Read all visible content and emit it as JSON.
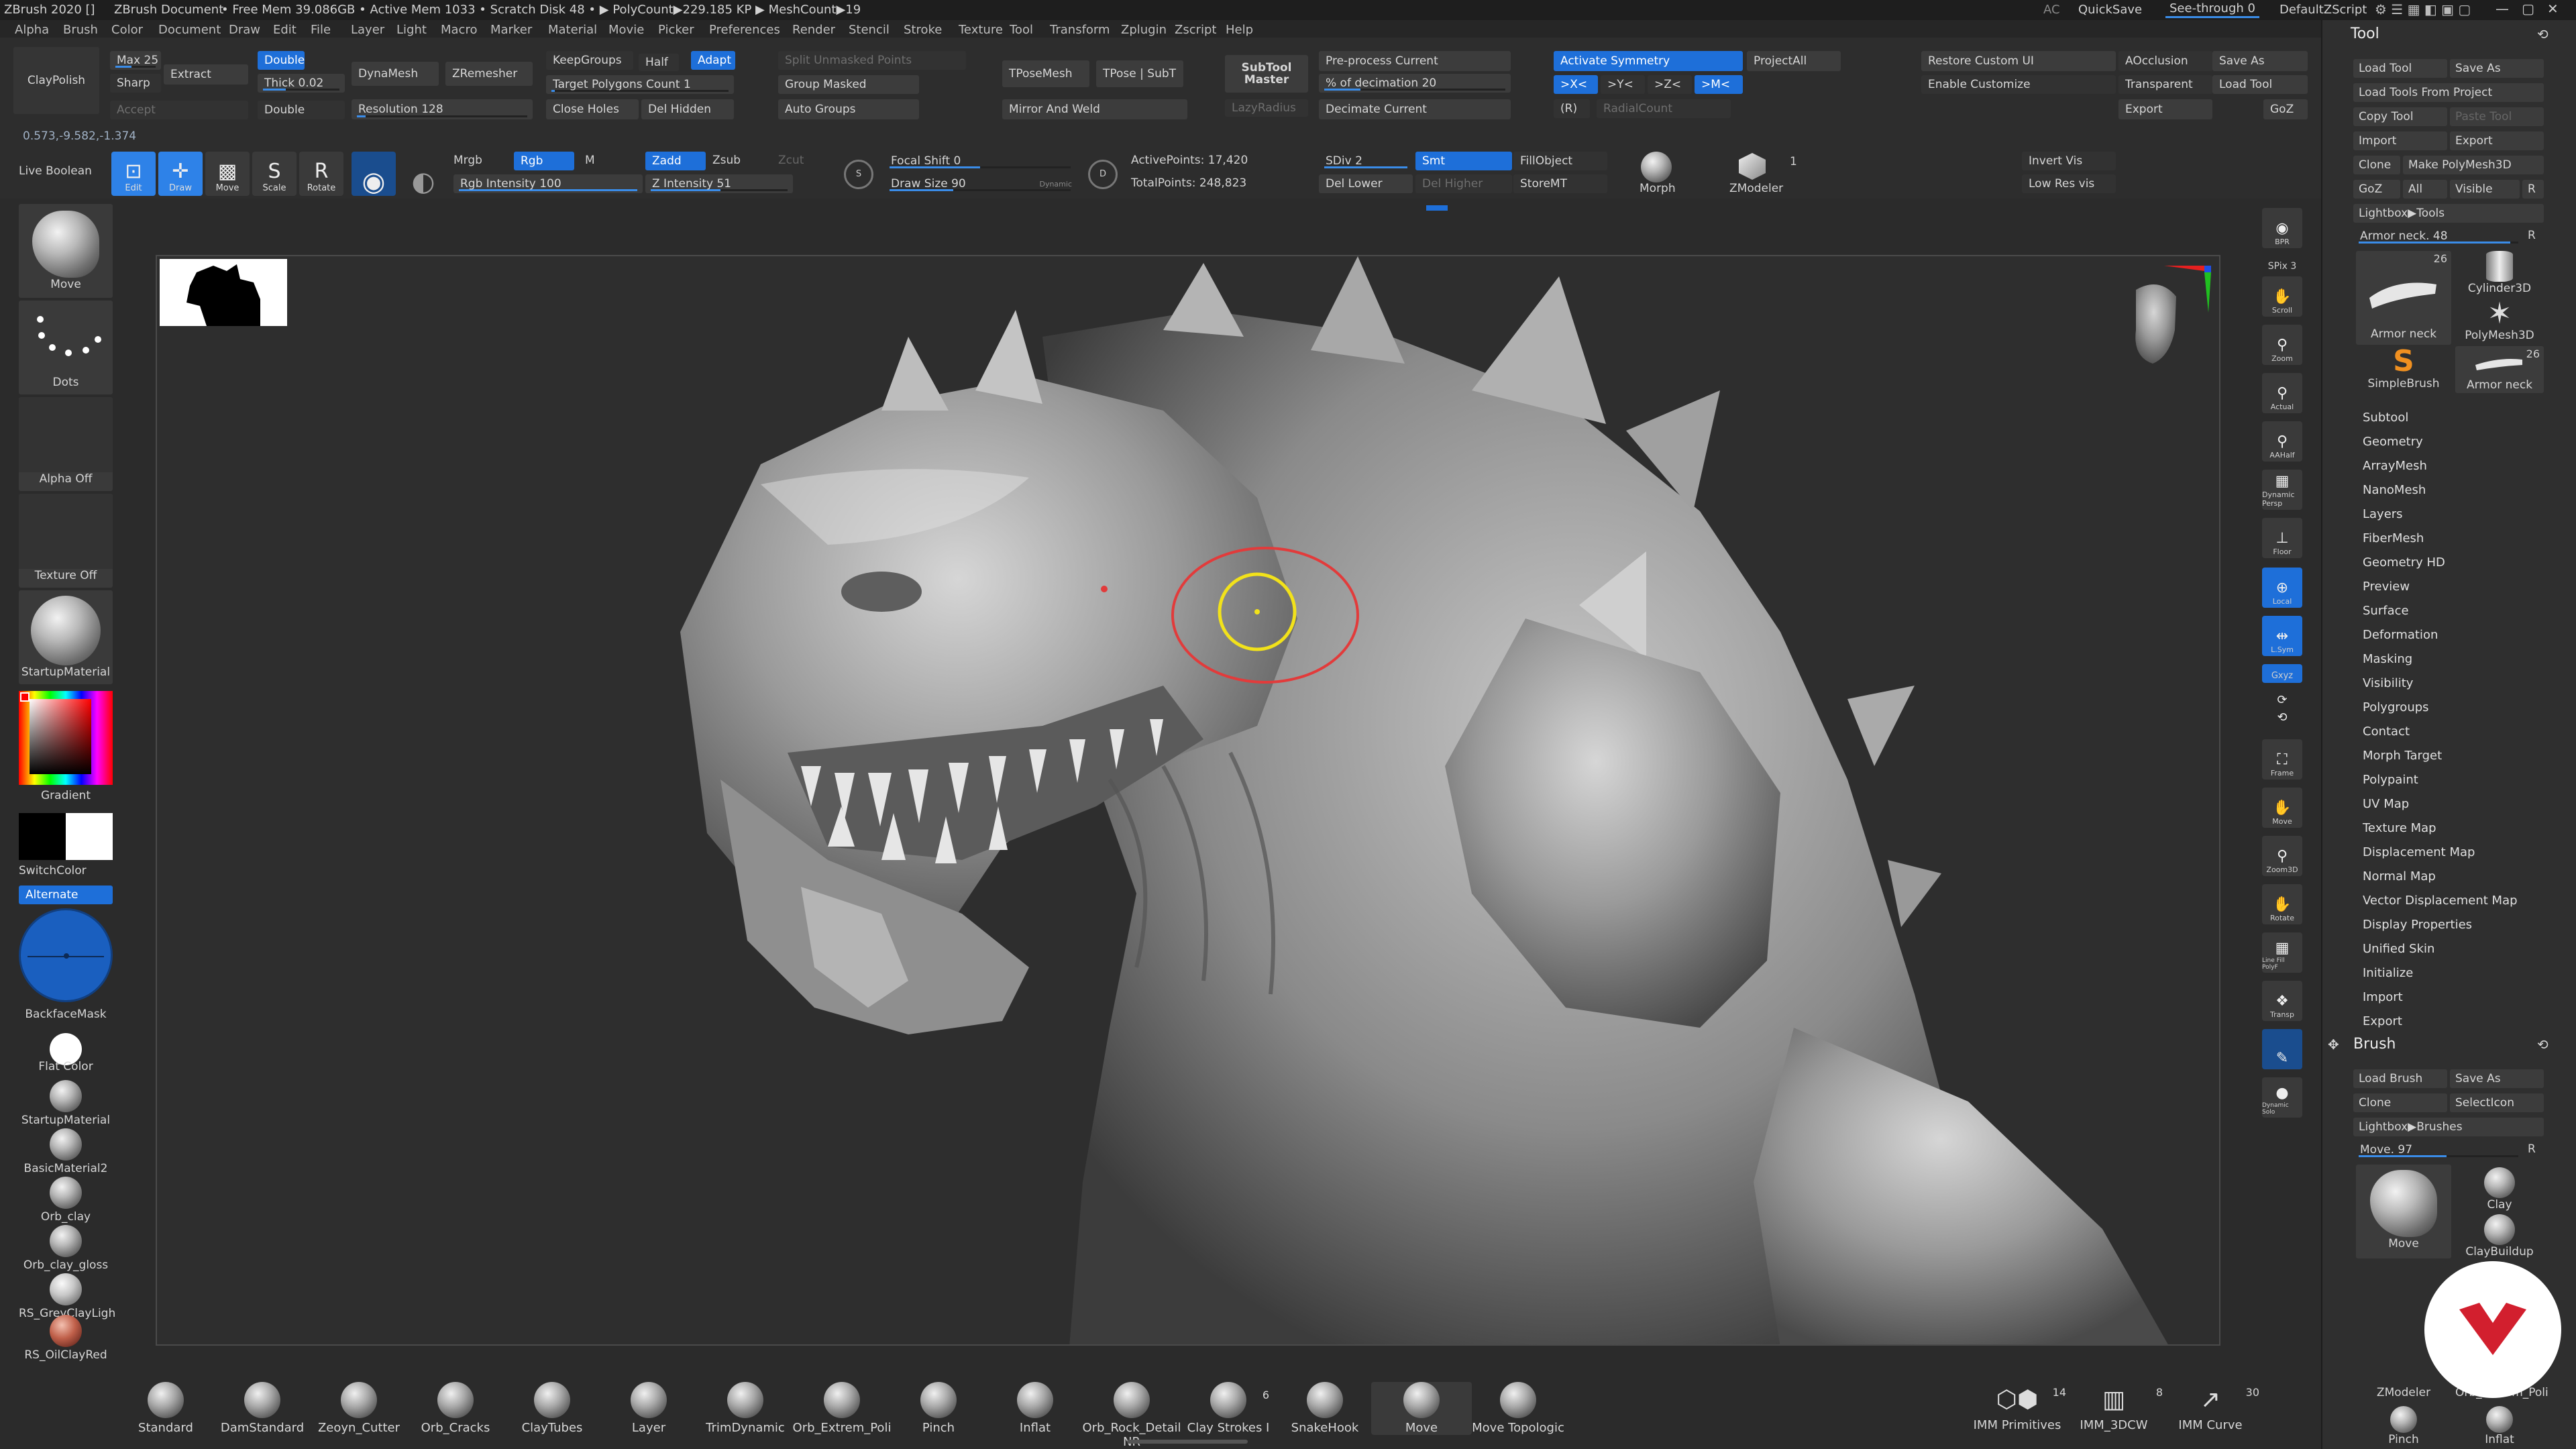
{
  "titlebar": {
    "app": "ZBrush 2020 []",
    "document": "ZBrush Document",
    "stats": "• Free Mem 39.086GB • Active Mem 1033 • Scratch Disk 48 • ▶ PolyCount▶229.185 KP ▶ MeshCount▶19",
    "ac": "AC",
    "quicksave": "QuickSave",
    "seethrough": "See-through  0",
    "script": "DefaultZScript"
  },
  "menu": [
    "Alpha",
    "Brush",
    "Color",
    "Document",
    "Draw",
    "Edit",
    "File",
    "Layer",
    "Light",
    "Macro",
    "Marker",
    "Material",
    "Movie",
    "Picker",
    "Preferences",
    "Render",
    "Stencil",
    "Stroke",
    "Texture",
    "Tool",
    "Transform",
    "Zplugin",
    "Zscript",
    "Help"
  ],
  "shelf1": {
    "claypolish": "ClayPolish",
    "max": "Max 25",
    "sharp": "Sharp",
    "extract": "Extract",
    "accept": "Accept",
    "double1": "Double",
    "thick": "Thick 0.02",
    "double2": "Double",
    "dynamesh": "DynaMesh",
    "zremesher": "ZRemesher",
    "resolution": "Resolution 128",
    "keepgroups": "KeepGroups",
    "half": "Half",
    "adapt": "Adapt",
    "target": "Target Polygons Count 1",
    "closeholes": "Close Holes",
    "delhidden": "Del Hidden",
    "splitunmasked": "Split Unmasked Points",
    "groupmasked": "Group Masked",
    "autogroups": "Auto Groups",
    "tposemesh": "TPoseMesh",
    "tposesubt": "TPose | SubT",
    "mirrorweld": "Mirror And Weld",
    "subtoolmaster": "SubTool Master",
    "lazyradius": "LazyRadius",
    "preprocess": "Pre-process Current",
    "decimation": "% of decimation 20",
    "decimate": "Decimate Current",
    "activatesym": "Activate Symmetry",
    "projectall": "ProjectAll",
    "symx": ">X<",
    "symy": ">Y<",
    "symz": ">Z<",
    "symm": ">M<",
    "symr": "(R)",
    "radialcount": "RadialCount",
    "restorecustom": "Restore Custom UI",
    "enablecustom": "Enable Customize",
    "aocclusion": "AOcclusion",
    "transparent": "Transparent",
    "export": "Export",
    "saveas": "Save As",
    "loadtool": "Load Tool",
    "goz": "GoZ"
  },
  "coords": "0.573,-9.582,-1.374",
  "shelf2": {
    "liveboolean": "Live Boolean",
    "edit": "Edit",
    "draw": "Draw",
    "move": "Move",
    "scale": "Scale",
    "rotate": "Rotate",
    "mrgb": "Mrgb",
    "rgb": "Rgb",
    "m": "M",
    "rgbintensity": "Rgb Intensity 100",
    "zadd": "Zadd",
    "zsub": "Zsub",
    "zcut": "Zcut",
    "zintensity": "Z Intensity 51",
    "focalshift": "Focal Shift 0",
    "drawsize": "Draw Size 90",
    "dynamic": "Dynamic",
    "activepoints": "ActivePoints: 17,420",
    "totalpoints": "TotalPoints: 248,823",
    "sdiv": "SDiv 2",
    "smt": "Smt",
    "dellower": "Del Lower",
    "delhigher": "Del Higher",
    "fillobject": "FillObject",
    "storemt": "StoreMT",
    "morph": "Morph",
    "zmodeler": "ZModeler",
    "zmodeler_count": "1",
    "invertvis": "Invert Vis",
    "lowresvis": "Low Res vis"
  },
  "left": {
    "brush": "Move",
    "stroke": "Dots",
    "alpha": "Alpha Off",
    "texture": "Texture Off",
    "material": "StartupMaterial",
    "gradient": "Gradient",
    "switchcolor": "SwitchColor",
    "alternate": "Alternate",
    "backfacemask": "BackfaceMask",
    "flatcolor": "Flat Color",
    "materials": [
      "StartupMaterial",
      "BasicMaterial2",
      "Orb_clay",
      "Orb_clay_gloss",
      "RS_GreyClayLigh",
      "RS_OilClayRed"
    ]
  },
  "rightnav": [
    "BPR",
    "SPix 3",
    "Scroll",
    "Zoom",
    "Actual",
    "AAHalf",
    "Dynamic Persp",
    "Floor",
    "Local",
    "L.Sym",
    "Gxyz",
    "Frame",
    "Move",
    "Zoom3D",
    "Rotate",
    "Line Fill PolyF",
    "Transp",
    "Dynamic Solo"
  ],
  "tool": {
    "title": "Tool",
    "loadtool": "Load Tool",
    "saveas": "Save As",
    "loadfromproject": "Load Tools From Project",
    "copytool": "Copy Tool",
    "pastetool": "Paste Tool",
    "import": "Import",
    "export": "Export",
    "clone": "Clone",
    "makepolymesh": "Make PolyMesh3D",
    "goz": "GoZ",
    "all": "All",
    "visible": "Visible",
    "r": "R",
    "lightbox": "Lightbox▶Tools",
    "armorneck": "Armor neck. 48",
    "thumbs": [
      {
        "name": "Armor neck",
        "count": "26"
      },
      {
        "name": "Cylinder3D",
        "count": ""
      },
      {
        "name": "PolyMesh3D",
        "count": ""
      },
      {
        "name": "SimpleBrush",
        "count": ""
      },
      {
        "name": "Armor neck",
        "count": "26"
      }
    ],
    "sections": [
      "Subtool",
      "Geometry",
      "ArrayMesh",
      "NanoMesh",
      "Layers",
      "FiberMesh",
      "Geometry HD",
      "Preview",
      "Surface",
      "Deformation",
      "Masking",
      "Visibility",
      "Polygroups",
      "Contact",
      "Morph Target",
      "Polypaint",
      "UV Map",
      "Texture Map",
      "Displacement Map",
      "Normal Map",
      "Vector Displacement Map",
      "Display Properties",
      "Unified Skin",
      "Initialize",
      "Import",
      "Export"
    ]
  },
  "brushpanel": {
    "title": "Brush",
    "loadbrush": "Load Brush",
    "saveas": "Save As",
    "clone": "Clone",
    "selecticon": "SelectIcon",
    "lightbox": "Lightbox▶Brushes",
    "move": "Move. 97",
    "r": "R",
    "thumbs": [
      "Move",
      "Clay",
      "ClayBuildup",
      "ZModeler",
      "Orb_Extrem_Poli",
      "Pinch",
      "Inflat"
    ]
  },
  "bottombrushes": [
    "Standard",
    "DamStandard",
    "Zeoyn_Cutter",
    "Orb_Cracks",
    "ClayTubes",
    "Layer",
    "TrimDynamic",
    "Orb_Extrem_Poli",
    "Pinch",
    "Inflat",
    "Orb_Rock_Detail NR",
    "Clay Strokes I",
    "SnakeHook",
    "Move",
    "Move Topologic"
  ],
  "bottom_counts": {
    "claystrokes": "6"
  },
  "imm": [
    {
      "name": "IMM Primitives",
      "count": "14"
    },
    {
      "name": "IMM_3DCW",
      "count": "8"
    },
    {
      "name": "IMM Curve",
      "count": "30"
    }
  ]
}
